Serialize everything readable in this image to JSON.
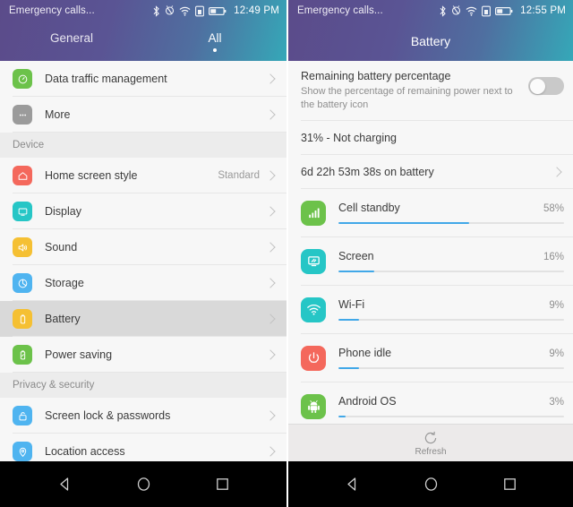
{
  "left": {
    "statusbar": {
      "title": "Emergency calls...",
      "time": "12:49 PM",
      "icons": [
        "bluetooth-icon",
        "vibrate-icon",
        "wifi-icon",
        "sim-icon",
        "battery-icon"
      ]
    },
    "tabs": [
      {
        "label": "General",
        "active": false
      },
      {
        "label": "All",
        "active": true
      }
    ],
    "items": [
      {
        "type": "row",
        "name": "data-traffic-management",
        "label": "Data traffic management",
        "value": "",
        "icon": "speedometer-icon",
        "color": "#6cc24a",
        "selected": false
      },
      {
        "type": "row",
        "name": "more",
        "label": "More",
        "value": "",
        "icon": "ellipsis-icon",
        "color": "#9b9b9b",
        "selected": false
      },
      {
        "type": "section",
        "name": "section-device",
        "label": "Device"
      },
      {
        "type": "row",
        "name": "home-screen-style",
        "label": "Home screen style",
        "value": "Standard",
        "icon": "home-icon",
        "color": "#f4685c",
        "selected": false
      },
      {
        "type": "row",
        "name": "display",
        "label": "Display",
        "value": "",
        "icon": "monitor-icon",
        "color": "#26c6c6",
        "selected": false
      },
      {
        "type": "row",
        "name": "sound",
        "label": "Sound",
        "value": "",
        "icon": "speaker-icon",
        "color": "#f5c033",
        "selected": false
      },
      {
        "type": "row",
        "name": "storage",
        "label": "Storage",
        "value": "",
        "icon": "pie-chart-icon",
        "color": "#4fb4f0",
        "selected": false
      },
      {
        "type": "row",
        "name": "battery",
        "label": "Battery",
        "value": "",
        "icon": "battery-icon",
        "color": "#f5c033",
        "selected": true
      },
      {
        "type": "row",
        "name": "power-saving",
        "label": "Power saving",
        "value": "",
        "icon": "battery-leaf-icon",
        "color": "#6cc24a",
        "selected": false
      },
      {
        "type": "section",
        "name": "section-privacy-security",
        "label": "Privacy & security"
      },
      {
        "type": "row",
        "name": "screen-lock-passwords",
        "label": "Screen lock & passwords",
        "value": "",
        "icon": "lock-icon",
        "color": "#4fb4f0",
        "selected": false
      },
      {
        "type": "row",
        "name": "location-access",
        "label": "Location access",
        "value": "",
        "icon": "location-pin-icon",
        "color": "#4fb4f0",
        "selected": false
      }
    ]
  },
  "right": {
    "statusbar": {
      "title": "Emergency calls...",
      "time": "12:55 PM"
    },
    "title": "Battery",
    "percentage_setting": {
      "title": "Remaining battery percentage",
      "subtitle": "Show the percentage of remaining power next to the battery icon",
      "enabled": false
    },
    "status_text": "31% - Not charging",
    "uptime_text": "6d 22h 53m 38s on battery",
    "usage": [
      {
        "name": "Cell standby",
        "percent": "58%",
        "value": 58,
        "icon": "signal-bars-icon",
        "color": "#6cc24a"
      },
      {
        "name": "Screen",
        "percent": "16%",
        "value": 16,
        "icon": "screen-icon",
        "color": "#26c6c6"
      },
      {
        "name": "Wi-Fi",
        "percent": "9%",
        "value": 9,
        "icon": "wifi-icon",
        "color": "#26c6c6"
      },
      {
        "name": "Phone idle",
        "percent": "9%",
        "value": 9,
        "icon": "power-icon",
        "color": "#f4685c"
      },
      {
        "name": "Android OS",
        "percent": "3%",
        "value": 3,
        "icon": "android-icon",
        "color": "#6cc24a"
      }
    ],
    "refresh": {
      "label": "Refresh",
      "icon": "refresh-icon"
    }
  },
  "navbar": {
    "back": "back-icon",
    "home": "home-icon",
    "recents": "recents-icon"
  },
  "colors": {
    "accent_bar": "#41a8e8",
    "header_start": "#5b4b8a",
    "header_end": "#35a8b8",
    "selected_row": "#d9d9d9"
  }
}
